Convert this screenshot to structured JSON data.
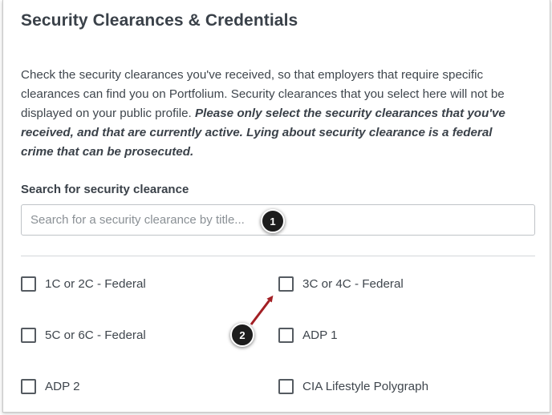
{
  "header": {
    "title": "Security Clearances & Credentials"
  },
  "description": {
    "text": "Check the security clearances you've received, so that employers that require specific clearances can find you on Portfolium. Security clearances that you select here will not be displayed on your public profile. ",
    "emphasis": "Please only select the security clearances that you've received, and that are currently active. Lying about security clearance is a federal crime that can be prosecuted."
  },
  "search": {
    "label": "Search for security clearance",
    "placeholder": "Search for a security clearance by title...",
    "value": ""
  },
  "clearances": [
    {
      "label": "1C or 2C - Federal",
      "checked": false
    },
    {
      "label": "3C or 4C - Federal",
      "checked": false
    },
    {
      "label": "5C or 6C - Federal",
      "checked": false
    },
    {
      "label": "ADP 1",
      "checked": false
    },
    {
      "label": "ADP 2",
      "checked": false
    },
    {
      "label": "CIA Lifestyle Polygraph",
      "checked": false
    }
  ],
  "callouts": [
    {
      "number": "1"
    },
    {
      "number": "2"
    }
  ],
  "colors": {
    "callout_bg": "#1d1d1d",
    "arrow": "#a31f24",
    "heading": "#3a4149",
    "body_text": "#3f464d"
  }
}
